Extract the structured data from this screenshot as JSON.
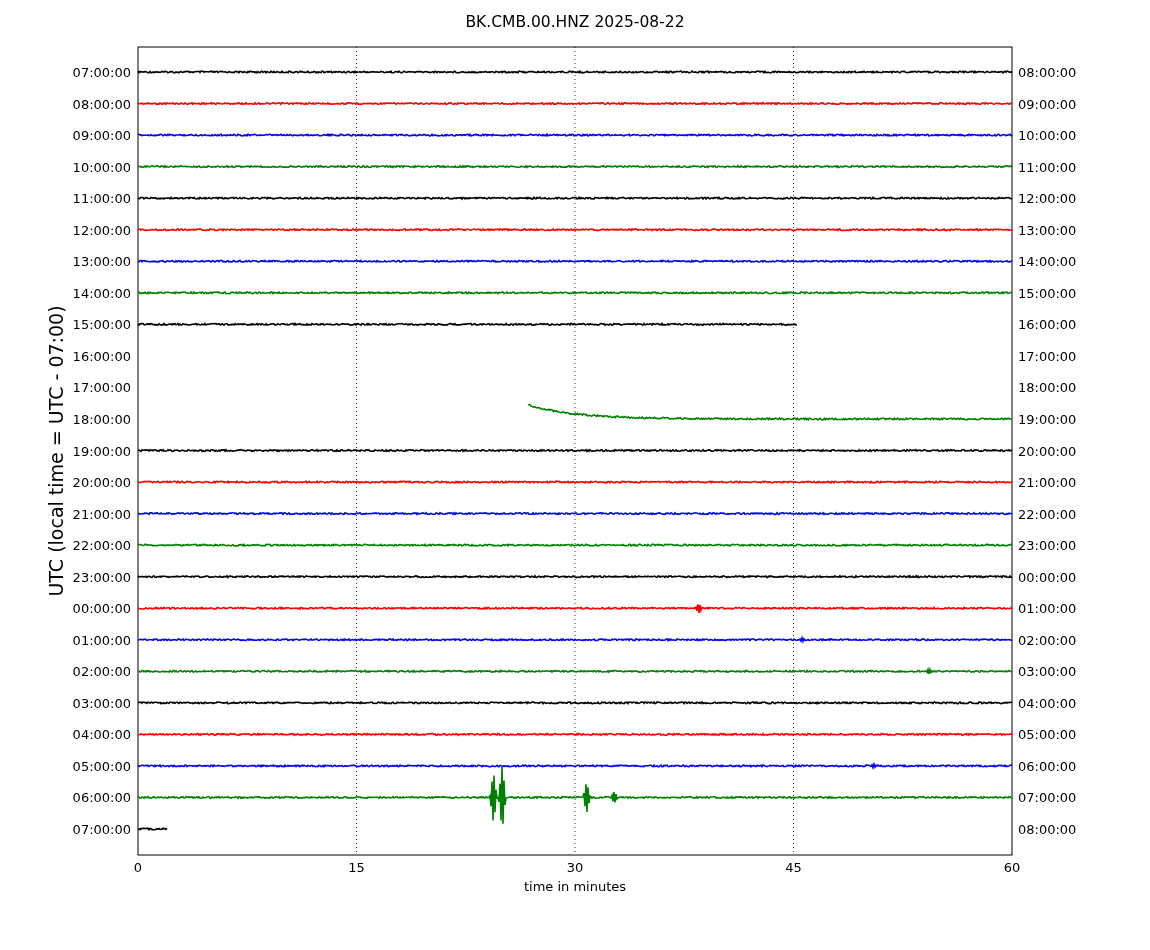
{
  "title": "BK.CMB.00.HNZ 2025-08-22",
  "y_axis": {
    "label": "UTC (local time = UTC - 07:00)"
  },
  "x_axis": {
    "label": "time in minutes",
    "ticks": [
      "0",
      "15",
      "30",
      "45",
      "60"
    ]
  },
  "traces": [
    {
      "left_label": "07:00:00",
      "right_label": "08:00:00",
      "color": "#000000",
      "kind": "full"
    },
    {
      "left_label": "08:00:00",
      "right_label": "09:00:00",
      "color": "#ff0000",
      "kind": "full"
    },
    {
      "left_label": "09:00:00",
      "right_label": "10:00:00",
      "color": "#0000ff",
      "kind": "full"
    },
    {
      "left_label": "10:00:00",
      "right_label": "11:00:00",
      "color": "#008000",
      "kind": "full"
    },
    {
      "left_label": "11:00:00",
      "right_label": "12:00:00",
      "color": "#000000",
      "kind": "full"
    },
    {
      "left_label": "12:00:00",
      "right_label": "13:00:00",
      "color": "#ff0000",
      "kind": "full"
    },
    {
      "left_label": "13:00:00",
      "right_label": "14:00:00",
      "color": "#0000ff",
      "kind": "full"
    },
    {
      "left_label": "14:00:00",
      "right_label": "15:00:00",
      "color": "#008000",
      "kind": "full"
    },
    {
      "left_label": "15:00:00",
      "right_label": "16:00:00",
      "color": "#000000",
      "kind": "ends"
    },
    {
      "left_label": "16:00:00",
      "right_label": "17:00:00",
      "kind": "gap"
    },
    {
      "left_label": "17:00:00",
      "right_label": "18:00:00",
      "kind": "gap"
    },
    {
      "left_label": "18:00:00",
      "right_label": "19:00:00",
      "color": "#008000",
      "kind": "resumes"
    },
    {
      "left_label": "19:00:00",
      "right_label": "20:00:00",
      "color": "#000000",
      "kind": "full"
    },
    {
      "left_label": "20:00:00",
      "right_label": "21:00:00",
      "color": "#ff0000",
      "kind": "full"
    },
    {
      "left_label": "21:00:00",
      "right_label": "22:00:00",
      "color": "#0000ff",
      "kind": "full"
    },
    {
      "left_label": "22:00:00",
      "right_label": "23:00:00",
      "color": "#008000",
      "kind": "full"
    },
    {
      "left_label": "23:00:00",
      "right_label": "00:00:00",
      "color": "#000000",
      "kind": "full"
    },
    {
      "left_label": "00:00:00",
      "right_label": "01:00:00",
      "color": "#ff0000",
      "kind": "event"
    },
    {
      "left_label": "01:00:00",
      "right_label": "02:00:00",
      "color": "#0000ff",
      "kind": "event"
    },
    {
      "left_label": "02:00:00",
      "right_label": "03:00:00",
      "color": "#008000",
      "kind": "event"
    },
    {
      "left_label": "03:00:00",
      "right_label": "04:00:00",
      "color": "#000000",
      "kind": "full"
    },
    {
      "left_label": "04:00:00",
      "right_label": "05:00:00",
      "color": "#ff0000",
      "kind": "full"
    },
    {
      "left_label": "05:00:00",
      "right_label": "06:00:00",
      "color": "#0000ff",
      "kind": "event"
    },
    {
      "left_label": "06:00:00",
      "right_label": "07:00:00",
      "color": "#008000",
      "kind": "event"
    },
    {
      "left_label": "07:00:00",
      "right_label": "08:00:00",
      "color": "#000000",
      "kind": "stub"
    }
  ]
}
